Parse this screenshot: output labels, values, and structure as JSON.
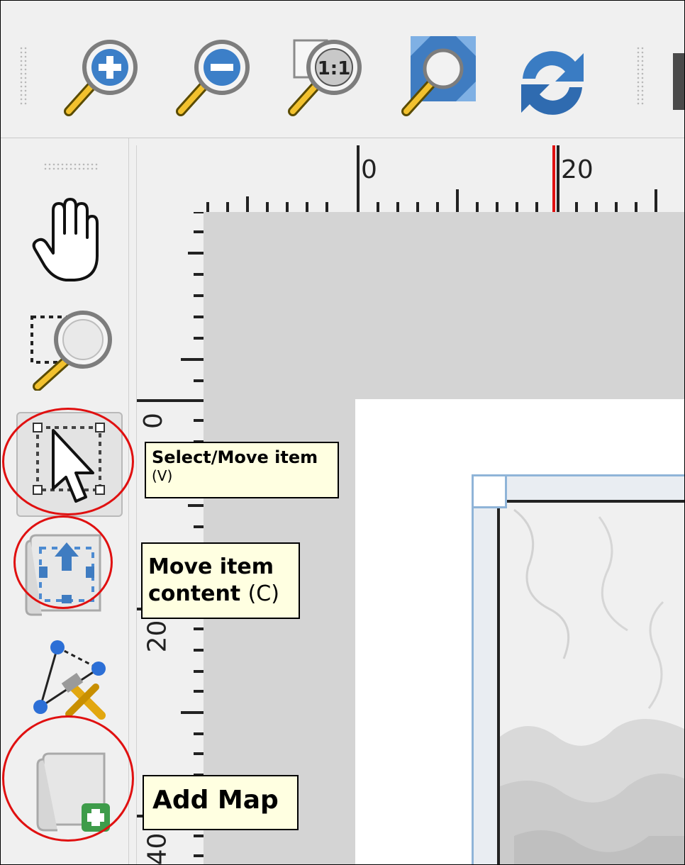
{
  "top_toolbar": {
    "tools": [
      {
        "name": "zoom-in",
        "icon": "zoom-in-icon"
      },
      {
        "name": "zoom-out",
        "icon": "zoom-out-icon"
      },
      {
        "name": "zoom-actual",
        "icon": "zoom-actual-icon",
        "label": "1:1"
      },
      {
        "name": "zoom-full",
        "icon": "zoom-full-icon"
      },
      {
        "name": "refresh",
        "icon": "refresh-icon"
      }
    ]
  },
  "left_toolbar": {
    "tools": [
      {
        "name": "pan",
        "icon": "hand-icon"
      },
      {
        "name": "zoom",
        "icon": "zoom-rect-icon"
      },
      {
        "name": "select-move",
        "icon": "select-move-icon",
        "active": true
      },
      {
        "name": "move-content",
        "icon": "move-content-icon"
      },
      {
        "name": "edit-nodes",
        "icon": "edit-nodes-icon"
      },
      {
        "name": "add-map",
        "icon": "add-map-icon"
      }
    ]
  },
  "ruler": {
    "top_labels": [
      "0",
      "20"
    ],
    "left_labels": [
      "0",
      "20",
      "40"
    ]
  },
  "tooltips": {
    "select_move": {
      "title": "Select/Move item",
      "shortcut": "(V)"
    },
    "move_content": {
      "line1": "Move item",
      "line2": "content",
      "shortcut": "(C)"
    },
    "add_map": {
      "title": "Add Map"
    }
  },
  "colors": {
    "highlight_circle": "#e01010",
    "ruler_marker": "#e01010",
    "tooltip_bg": "#ffffe1",
    "map_frame": "#8fb4d8"
  }
}
